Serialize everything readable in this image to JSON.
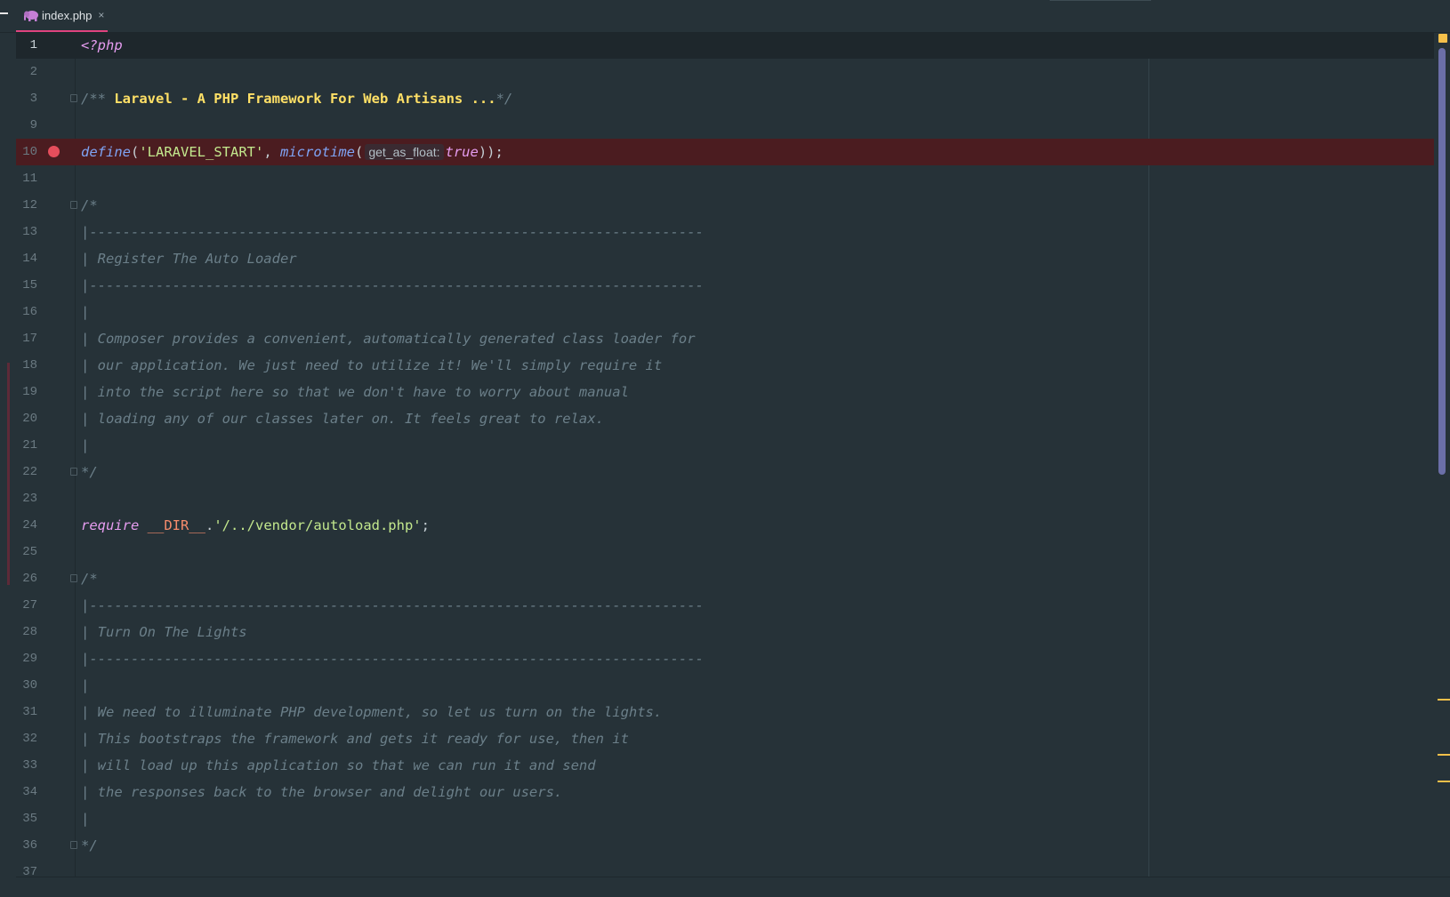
{
  "tab": {
    "label": "index.php",
    "close": "×"
  },
  "lines": [
    {
      "n": "1",
      "top": 0
    },
    {
      "n": "2"
    },
    {
      "n": "3"
    },
    {
      "n": "9"
    },
    {
      "n": "10"
    },
    {
      "n": "11"
    },
    {
      "n": "12"
    },
    {
      "n": "13"
    },
    {
      "n": "14"
    },
    {
      "n": "15"
    },
    {
      "n": "16"
    },
    {
      "n": "17"
    },
    {
      "n": "18"
    },
    {
      "n": "19"
    },
    {
      "n": "20"
    },
    {
      "n": "21"
    },
    {
      "n": "22"
    },
    {
      "n": "23"
    },
    {
      "n": "24"
    },
    {
      "n": "25"
    },
    {
      "n": "26"
    },
    {
      "n": "27"
    },
    {
      "n": "28"
    },
    {
      "n": "29"
    },
    {
      "n": "30"
    },
    {
      "n": "31"
    },
    {
      "n": "32"
    },
    {
      "n": "33"
    },
    {
      "n": "34"
    },
    {
      "n": "35"
    },
    {
      "n": "36"
    },
    {
      "n": "37"
    }
  ],
  "code": {
    "php_open": "<?php",
    "doc_open": "/** ",
    "doc_title": "Laravel - A PHP Framework For Web Artisans ...",
    "doc_close": "*/",
    "define_fn": "define",
    "define_p1": "(",
    "define_str": "'LARAVEL_START'",
    "define_comma": ", ",
    "microtime_fn": "microtime",
    "microtime_p1": "(",
    "hint": "get_as_float:",
    "true_kw": "true",
    "define_close": "));",
    "c1_open": "/*",
    "c1_rule": "|--------------------------------------------------------------------------",
    "c1_title": "| Register The Auto Loader",
    "c1_bar": "|",
    "c1_t1": "| Composer provides a convenient, automatically generated class loader for",
    "c1_t2": "| our application. We just need to utilize it! We'll simply require it",
    "c1_t3": "| into the script here so that we don't have to worry about manual",
    "c1_t4": "| loading any of our classes later on. It feels great to relax.",
    "c1_close": "*/",
    "require_kw": "require",
    "dir_const": "__DIR__",
    "dot": ".",
    "require_str": "'/../vendor/autoload.php'",
    "semi": ";",
    "c2_open": "/*",
    "c2_rule": "|--------------------------------------------------------------------------",
    "c2_title": "| Turn On The Lights",
    "c2_bar": "|",
    "c2_t1": "| We need to illuminate PHP development, so let us turn on the lights.",
    "c2_t2": "| This bootstraps the framework and gets it ready for use, then it",
    "c2_t3": "| will load up this application so that we can run it and send",
    "c2_t4": "| the responses back to the browser and delight our users.",
    "c2_close": "*/"
  },
  "colors": {
    "background": "#263238",
    "breakpoint": "#e64e5c",
    "breakpoint_line": "#4b1c20",
    "tab_underline": "#e0437f",
    "warning": "#f5c04a"
  }
}
